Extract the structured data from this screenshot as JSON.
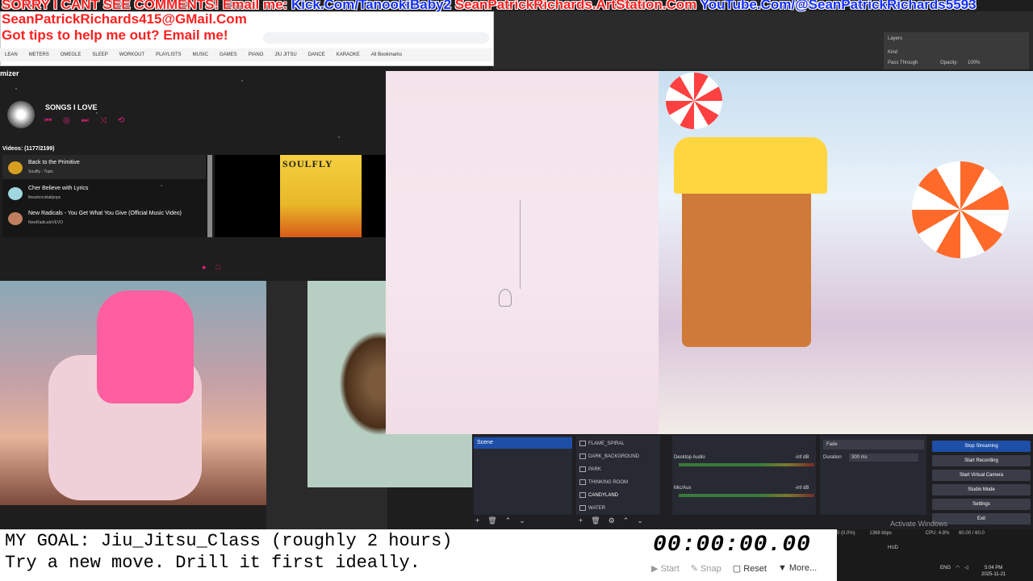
{
  "banner": {
    "line1_prefix": "SORRY I CANT SEE COMMENTS! Email me:",
    "line1_kick": "Kick.Com/TanookiBaby2",
    "line1_artstation": "SeanPatrickRichards.ArtStation.Com",
    "line1_youtube": "YouTube.Com/@SeanPatrickRichards5593",
    "line2": "SeanPatrickRichards415@GMail.Com",
    "line3": "Got tips to help me out? Email me!"
  },
  "browser": {
    "bookmarks": [
      "LEAN",
      "METERS",
      "OMEGLE",
      "SLEEP",
      "WORKOUT",
      "PLAYLISTS",
      "MUSIC",
      "GAMES",
      "PIANO",
      "JIU JITSU",
      "DANCE",
      "KARAOKE",
      "All Bookmarks"
    ]
  },
  "music": {
    "app_title": "mizer",
    "playlist_name": "SONGS I LOVE",
    "videos_count": "Videos: (1177/2199)",
    "videos": [
      {
        "title": "Back to the Primitive",
        "channel": "Soulfly - Topic"
      },
      {
        "title": "Cher Believe with Lyrics",
        "channel": "theartcocktailpops"
      },
      {
        "title": "New Radicals - You Get What You Give (Official Music Video)",
        "channel": "NewRadicalsVEVO"
      }
    ],
    "album_text": "SOULFLY"
  },
  "obs": {
    "scene": "Scene",
    "sources": [
      "FLAME_SPIRAL",
      "DARK_BACKGROUND",
      "PARK",
      "THINKING ROOM",
      "CANDYLAND",
      "WATER"
    ],
    "mixer": {
      "desktop_label": "Desktop Audio",
      "desktop_db": "-inf dB",
      "mic_label": "Mic/Aux",
      "mic_db": "-inf dB"
    },
    "transition": "Fade",
    "duration_label": "Duration",
    "duration_value": "300 ms",
    "controls": [
      "Stop Streaming",
      "Start Recording",
      "Start Virtual Camera",
      "Studio Mode",
      "Settings",
      "Exit"
    ]
  },
  "status_bar": {
    "dropped": "0 (0.0%)",
    "kbps": "1368 kbps",
    "cpu": "CPU: 4.8%",
    "fps": "60.00 / 60.0"
  },
  "activate_windows": "Activate Windows",
  "goal": {
    "line1": "MY GOAL: Jiu_Jitsu_Class (roughly 2 hours)",
    "line2": "Try a new move. Drill it first ideally."
  },
  "timer": {
    "display": "00:00:00.00",
    "start": "Start",
    "snap": "Snap",
    "reset": "Reset",
    "more": "More..."
  },
  "tray": {
    "lang": "ENG",
    "time": "5:04 PM",
    "date": "2025-11-21"
  },
  "photoshop": {
    "layers_label": "Layers",
    "kind_label": "Kind",
    "blend_mode": "Pass Through",
    "opacity_label": "Opacity:",
    "opacity_value": "100%",
    "layer_name": "HUD"
  }
}
